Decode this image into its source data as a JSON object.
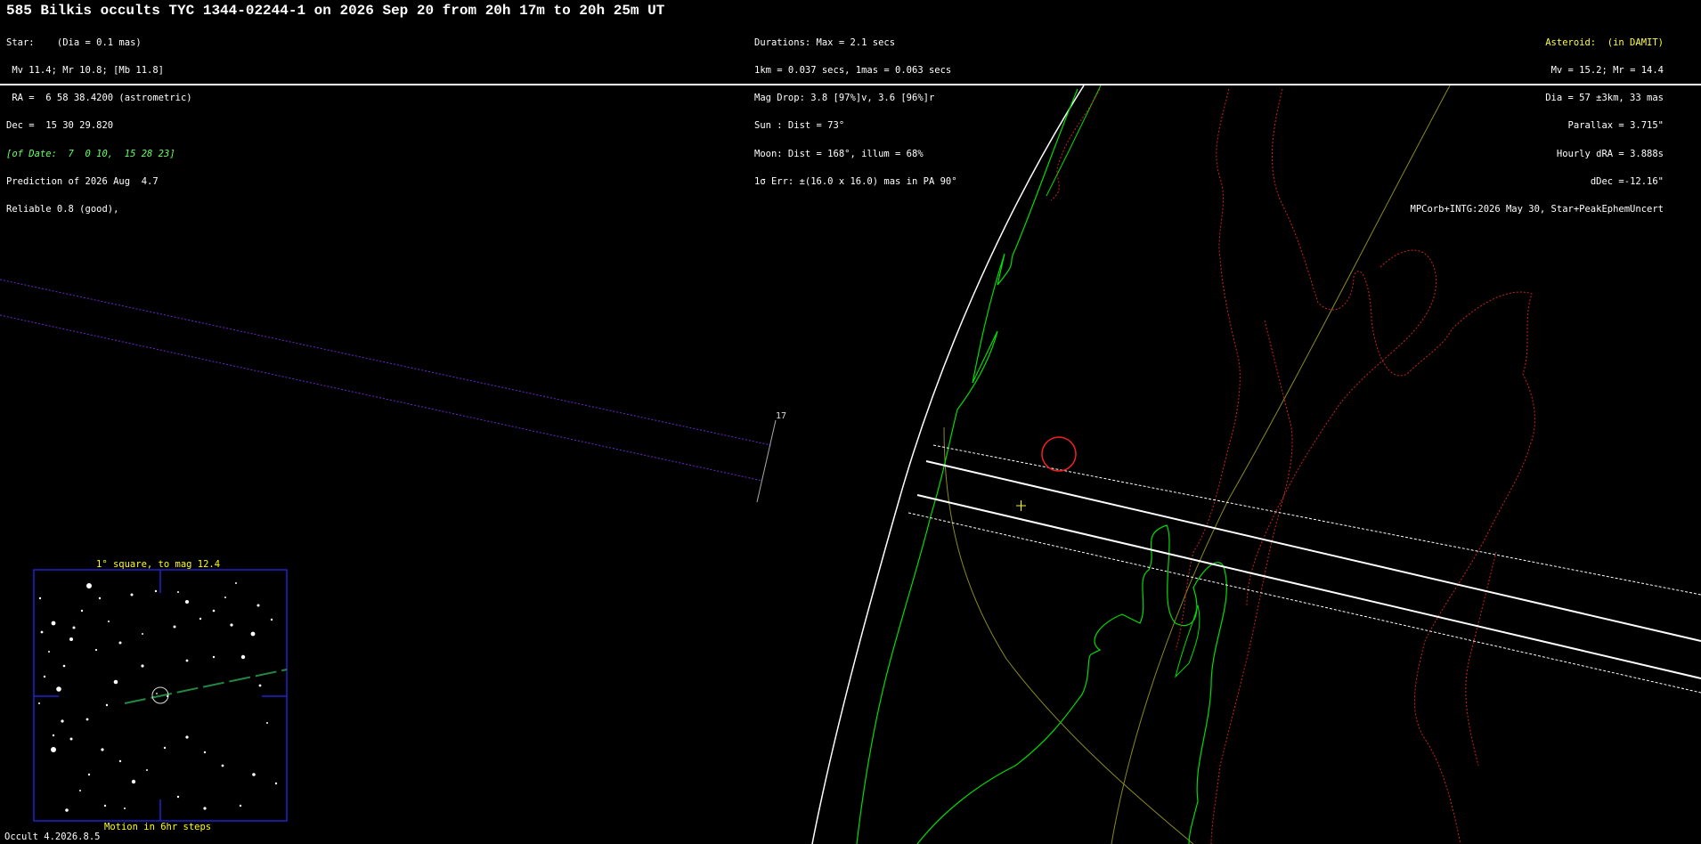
{
  "title": "585 Bilkis occults TYC 1344-02244-1 on 2026 Sep 20 from 20h 17m to 20h 25m UT",
  "star_info": [
    "Star:    (Dia = 0.1 mas)",
    " Mv 11.4; Mr 10.8; [Mb 11.8]",
    " RA =  6 58 38.4200 (astrometric)",
    "Dec =  15 30 29.820",
    "[of Date:  7  0 10,  15 28 23]",
    "Prediction of 2026 Aug  4.7",
    "Reliable 0.8 (good),"
  ],
  "event_info": [
    "Durations: Max = 2.1 secs",
    "1km = 0.037 secs, 1mas = 0.063 secs",
    "Mag Drop: 3.8 [97%]v, 3.6 [96%]r",
    "Sun : Dist = 73°",
    "Moon: Dist = 168°, illum = 68%",
    "1σ Err: ±(16.0 x 16.0) mas in PA 90°"
  ],
  "asteroid_info": [
    "Asteroid:  (in DAMIT)",
    "Mv = 15.2; Mr = 14.4",
    "Dia = 57 ±3km, 33 mas",
    "Parallax = 3.715\"",
    "Hourly dRA = 3.888s",
    "dDec =-12.16\"",
    "MPCorb+INTG:2026 May 30, Star+PeakEphemUncert"
  ],
  "map": {
    "path_label": "17",
    "colors": {
      "limb": "#ffffff",
      "coast": "#00dd00",
      "borders": "#cc2222",
      "path": "#ffffff",
      "sigma": "#ffffff",
      "prior_path": "#6a2acc",
      "grid": "#8a8a20",
      "circle": "#ee2222",
      "center_mark": "#ffff00"
    }
  },
  "inset": {
    "caption_top": "1° square, to mag 12.4",
    "caption_bottom": "Motion in 6hr steps"
  },
  "footer": "Occult 4.2026.8.5"
}
